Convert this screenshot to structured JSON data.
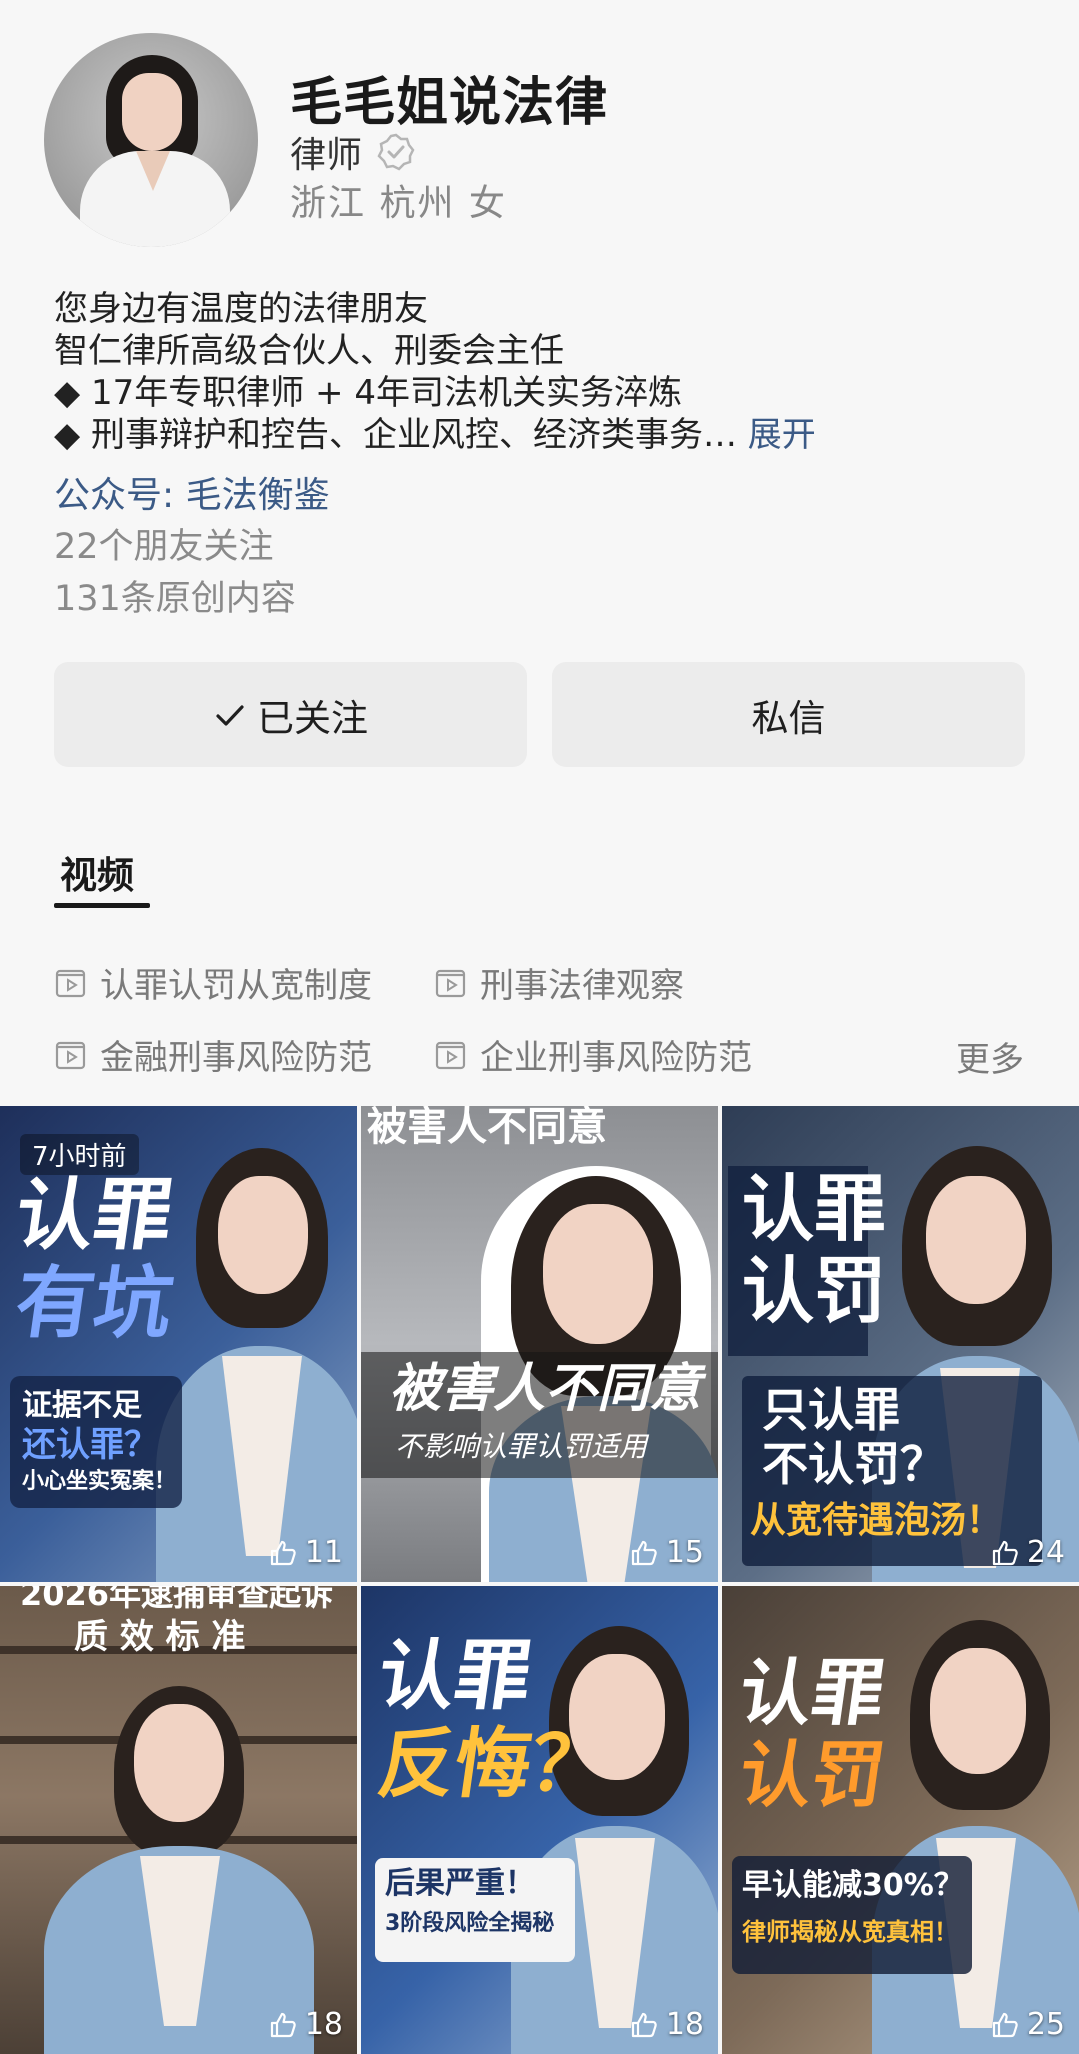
{
  "profile": {
    "name": "毛毛姐说法律",
    "title": "律师",
    "location": "浙江 杭州 女",
    "bio_lines": [
      "您身边有温度的法律朋友",
      "智仁律所高级合伙人、刑委会主任",
      "◆ 17年专职律师 + 4年司法机关实务淬炼",
      "◆ 刑事辩护和控告、企业风控、经济类事务…"
    ],
    "expand_label": "展开",
    "wechat": "公众号: 毛法衡鉴",
    "friends_following": "22个朋友关注",
    "original_count": "131条原创内容"
  },
  "actions": {
    "follow_label": "已关注",
    "message_label": "私信"
  },
  "tabs": {
    "videos": "视频"
  },
  "collections": [
    {
      "label": "认罪认罚从宽制度"
    },
    {
      "label": "刑事法律观察"
    },
    {
      "label": "金融刑事风险防范"
    },
    {
      "label": "企业刑事风险防范"
    }
  ],
  "more_label": "更多",
  "videos": [
    {
      "time": "7小时前",
      "cap1": "认罪",
      "cap2": "有坑",
      "cap3": "证据不足",
      "cap4": "还认罪？",
      "cap5": "小心坐实冤案！",
      "likes": "11"
    },
    {
      "cap_top": "被害人不同意",
      "cap1": "被害人不同意",
      "cap2": "不影响认罪认罚适用",
      "likes": "15"
    },
    {
      "cap1": "认罪",
      "cap2": "认罚",
      "cap3": "只认罪",
      "cap4": "不认罚？",
      "cap5": "从宽待遇泡汤！",
      "likes": "24"
    },
    {
      "cap_top": "2026年逮捕审查起诉",
      "cap1": "质 效 标 准",
      "likes": "18"
    },
    {
      "cap1": "认罪",
      "cap2": "反悔？",
      "cap3": "后果严重！",
      "cap4": "3阶段风险全揭秘",
      "likes": "18"
    },
    {
      "cap1": "认罪",
      "cap2": "认罚",
      "cap3": "早认能减30%？",
      "cap4": "律师揭秘从宽真相！",
      "likes": "25"
    }
  ],
  "colors": {
    "link": "#3b5a86",
    "button_bg": "#ececec",
    "page_bg": "#f7f7f7"
  }
}
